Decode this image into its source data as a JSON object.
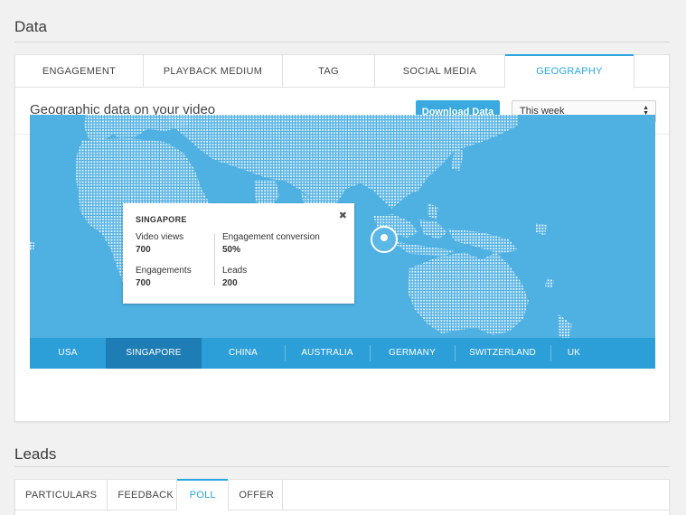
{
  "data_section": {
    "title": "Data"
  },
  "tabs": [
    {
      "label": "ENGAGEMENT",
      "active": false
    },
    {
      "label": "PLAYBACK MEDIUM",
      "active": false
    },
    {
      "label": "TAG",
      "active": false
    },
    {
      "label": "SOCIAL MEDIA",
      "active": false
    },
    {
      "label": "GEOGRAPHY",
      "active": true
    }
  ],
  "toolbar": {
    "heading": "Geographic data on your video",
    "download_label": "Download Data",
    "range_value": "This week"
  },
  "popup": {
    "country": "SINGAPORE",
    "stats": {
      "video_views": {
        "label": "Video views",
        "value": "700"
      },
      "engagement_conversion": {
        "label": "Engagement conversion",
        "value": "50%"
      },
      "engagements": {
        "label": "Engagements",
        "value": "700"
      },
      "leads": {
        "label": "Leads",
        "value": "200"
      }
    }
  },
  "countries": [
    {
      "label": "USA",
      "active": false
    },
    {
      "label": "SINGAPORE",
      "active": true
    },
    {
      "label": "CHINA",
      "active": false
    },
    {
      "label": "AUSTRALIA",
      "active": false
    },
    {
      "label": "GERMANY",
      "active": false
    },
    {
      "label": "SWITZERLAND",
      "active": false
    },
    {
      "label": "UK",
      "active": false
    }
  ],
  "leads_section": {
    "title": "Leads"
  },
  "leads_tabs": [
    {
      "label": "PARTICULARS",
      "active": false
    },
    {
      "label": "FEEDBACK",
      "active": false
    },
    {
      "label": "POLL",
      "active": true
    },
    {
      "label": "OFFER",
      "active": false
    }
  ],
  "colors": {
    "accent": "#2aa6e0",
    "map_bg": "#4fb0e2",
    "country_bar": "#2d9fd8",
    "country_active": "#1d7db4"
  }
}
